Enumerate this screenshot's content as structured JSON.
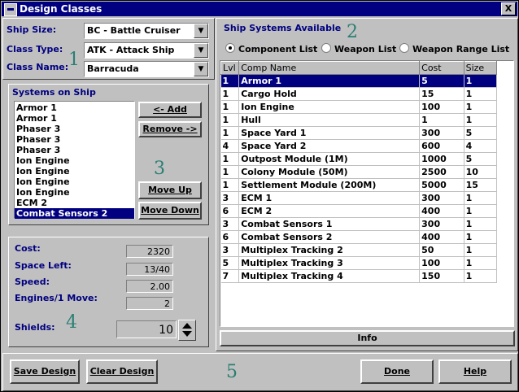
{
  "window": {
    "title": "Design Classes",
    "close_label": "X"
  },
  "left": {
    "ship_size_label": "Ship Size:",
    "ship_size_value": "BC - Battle Cruiser",
    "class_type_label": "Class Type:",
    "class_type_value": "ATK - Attack Ship",
    "class_name_label": "Class Name:",
    "class_name_value": "Barracuda",
    "marker1": "1"
  },
  "systems": {
    "title": "Systems on Ship",
    "items": [
      "Armor 1",
      "Armor 1",
      "Phaser 3",
      "Phaser 3",
      "Phaser 3",
      "Ion Engine",
      "Ion Engine",
      "Ion Engine",
      "Ion Engine",
      "ECM 2",
      "Combat Sensors 2"
    ],
    "selected_index": 10,
    "add_label": "<- Add",
    "remove_label": "Remove ->",
    "move_up_label": "Move Up",
    "move_down_label": "Move Down",
    "marker3": "3"
  },
  "stats": {
    "cost_label": "Cost:",
    "cost_value": "2320",
    "space_label": "Space Left:",
    "space_value": "13/40",
    "speed_label": "Speed:",
    "speed_value": "2.00",
    "engines_label": "Engines/1 Move:",
    "engines_value": "2",
    "shields_label": "Shields:",
    "shields_value": "10",
    "marker4": "4"
  },
  "right": {
    "title": "Ship Systems Available",
    "marker2": "2",
    "radio_component": "Component List",
    "radio_weapon": "Weapon List",
    "radio_range": "Weapon Range List",
    "selected_radio": "component",
    "columns": [
      "Lvl",
      "Comp Name",
      "Cost",
      "Size"
    ],
    "rows": [
      [
        "1",
        "Armor 1",
        "5",
        "1"
      ],
      [
        "1",
        "Cargo Hold",
        "15",
        "1"
      ],
      [
        "1",
        "Ion Engine",
        "100",
        "1"
      ],
      [
        "1",
        "Hull",
        "1",
        "1"
      ],
      [
        "1",
        "Space Yard 1",
        "300",
        "5"
      ],
      [
        "4",
        "Space Yard 2",
        "600",
        "4"
      ],
      [
        "1",
        "Outpost Module (1M)",
        "1000",
        "5"
      ],
      [
        "1",
        "Colony Module (50M)",
        "2500",
        "10"
      ],
      [
        "1",
        "Settlement Module (200M)",
        "5000",
        "15"
      ],
      [
        "3",
        "ECM 1",
        "300",
        "1"
      ],
      [
        "6",
        "ECM 2",
        "400",
        "1"
      ],
      [
        "3",
        "Combat Sensors 1",
        "300",
        "1"
      ],
      [
        "6",
        "Combat Sensors 2",
        "400",
        "1"
      ],
      [
        "3",
        "Multiplex Tracking 2",
        "50",
        "1"
      ],
      [
        "5",
        "Multiplex Tracking 3",
        "100",
        "1"
      ],
      [
        "7",
        "Multiplex Tracking 4",
        "150",
        "1"
      ]
    ],
    "selected_row": 0,
    "info_label": "Info"
  },
  "bottom": {
    "save_label": "Save Design",
    "clear_label": "Clear Design",
    "done_label": "Done",
    "help_label": "Help",
    "marker5": "5"
  },
  "colors": {
    "title_bar": "#000080",
    "label_text": "#000080",
    "marker": "#2a7f74",
    "selection": "#000080"
  }
}
